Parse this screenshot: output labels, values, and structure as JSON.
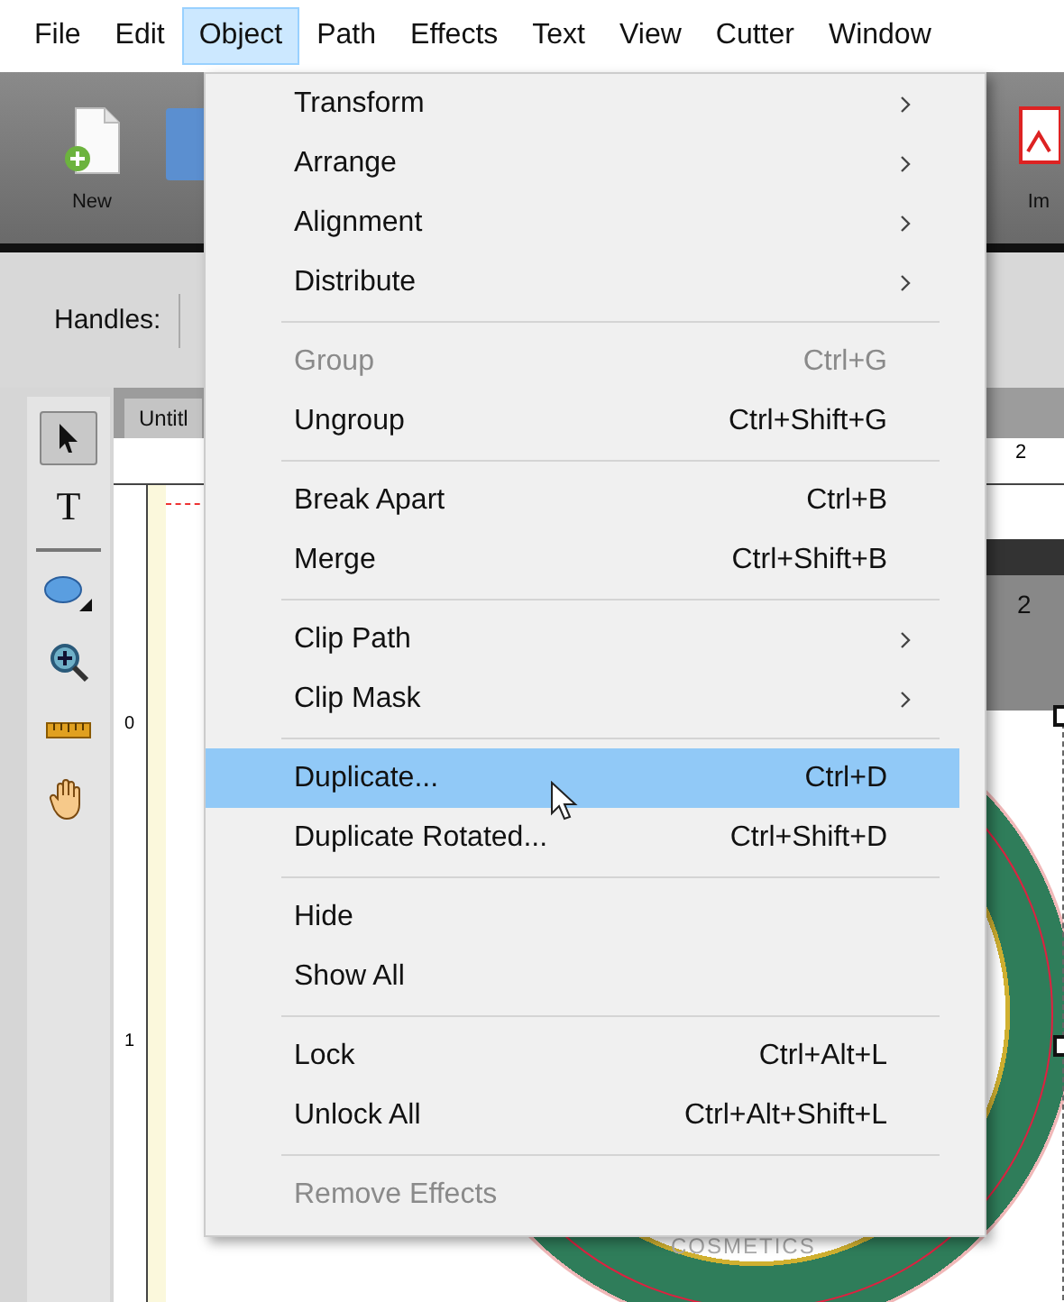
{
  "menubar": [
    {
      "label": "File",
      "selected": false
    },
    {
      "label": "Edit",
      "selected": false
    },
    {
      "label": "Object",
      "selected": true
    },
    {
      "label": "Path",
      "selected": false
    },
    {
      "label": "Effects",
      "selected": false
    },
    {
      "label": "Text",
      "selected": false
    },
    {
      "label": "View",
      "selected": false
    },
    {
      "label": "Cutter",
      "selected": false
    },
    {
      "label": "Window",
      "selected": false
    }
  ],
  "toolbar": {
    "buttons": [
      {
        "label": "New",
        "kind": "new"
      },
      {
        "label": "Im",
        "kind": "image"
      }
    ]
  },
  "handles_bar": {
    "label": "Handles:"
  },
  "tools": [
    {
      "kind": "pointer",
      "selected": true
    },
    {
      "kind": "text",
      "glyph": "T",
      "selected": false
    },
    {
      "kind": "ellipse",
      "selected": false
    },
    {
      "kind": "zoom",
      "selected": false
    },
    {
      "kind": "measure",
      "selected": false
    },
    {
      "kind": "hand",
      "selected": false
    }
  ],
  "document": {
    "tab": "Untitl",
    "hruler_label": "2",
    "vruler_labels": [
      "0",
      "1"
    ],
    "band_label": "2",
    "artwork_text": "COSMETICS"
  },
  "menu": {
    "sections": [
      [
        {
          "label": "Transform",
          "submenu": true,
          "disabled": false,
          "selected": false
        },
        {
          "label": "Arrange",
          "submenu": true,
          "disabled": false,
          "selected": false
        },
        {
          "label": "Alignment",
          "submenu": true,
          "disabled": false,
          "selected": false
        },
        {
          "label": "Distribute",
          "submenu": true,
          "disabled": false,
          "selected": false
        }
      ],
      [
        {
          "label": "Group",
          "shortcut": "Ctrl+G",
          "disabled": true,
          "selected": false
        },
        {
          "label": "Ungroup",
          "shortcut": "Ctrl+Shift+G",
          "disabled": false,
          "selected": false
        }
      ],
      [
        {
          "label": "Break Apart",
          "shortcut": "Ctrl+B",
          "disabled": false,
          "selected": false
        },
        {
          "label": "Merge",
          "shortcut": "Ctrl+Shift+B",
          "disabled": false,
          "selected": false
        }
      ],
      [
        {
          "label": "Clip Path",
          "submenu": true,
          "disabled": false,
          "selected": false
        },
        {
          "label": "Clip Mask",
          "submenu": true,
          "disabled": false,
          "selected": false
        }
      ],
      [
        {
          "label": "Duplicate...",
          "shortcut": "Ctrl+D",
          "disabled": false,
          "selected": true
        },
        {
          "label": "Duplicate Rotated...",
          "shortcut": "Ctrl+Shift+D",
          "disabled": false,
          "selected": false
        }
      ],
      [
        {
          "label": "Hide",
          "disabled": false,
          "selected": false
        },
        {
          "label": "Show All",
          "disabled": false,
          "selected": false
        }
      ],
      [
        {
          "label": "Lock",
          "shortcut": "Ctrl+Alt+L",
          "disabled": false,
          "selected": false
        },
        {
          "label": "Unlock All",
          "shortcut": "Ctrl+Alt+Shift+L",
          "disabled": false,
          "selected": false
        }
      ],
      [
        {
          "label": "Remove Effects",
          "disabled": true,
          "selected": false
        }
      ]
    ]
  }
}
